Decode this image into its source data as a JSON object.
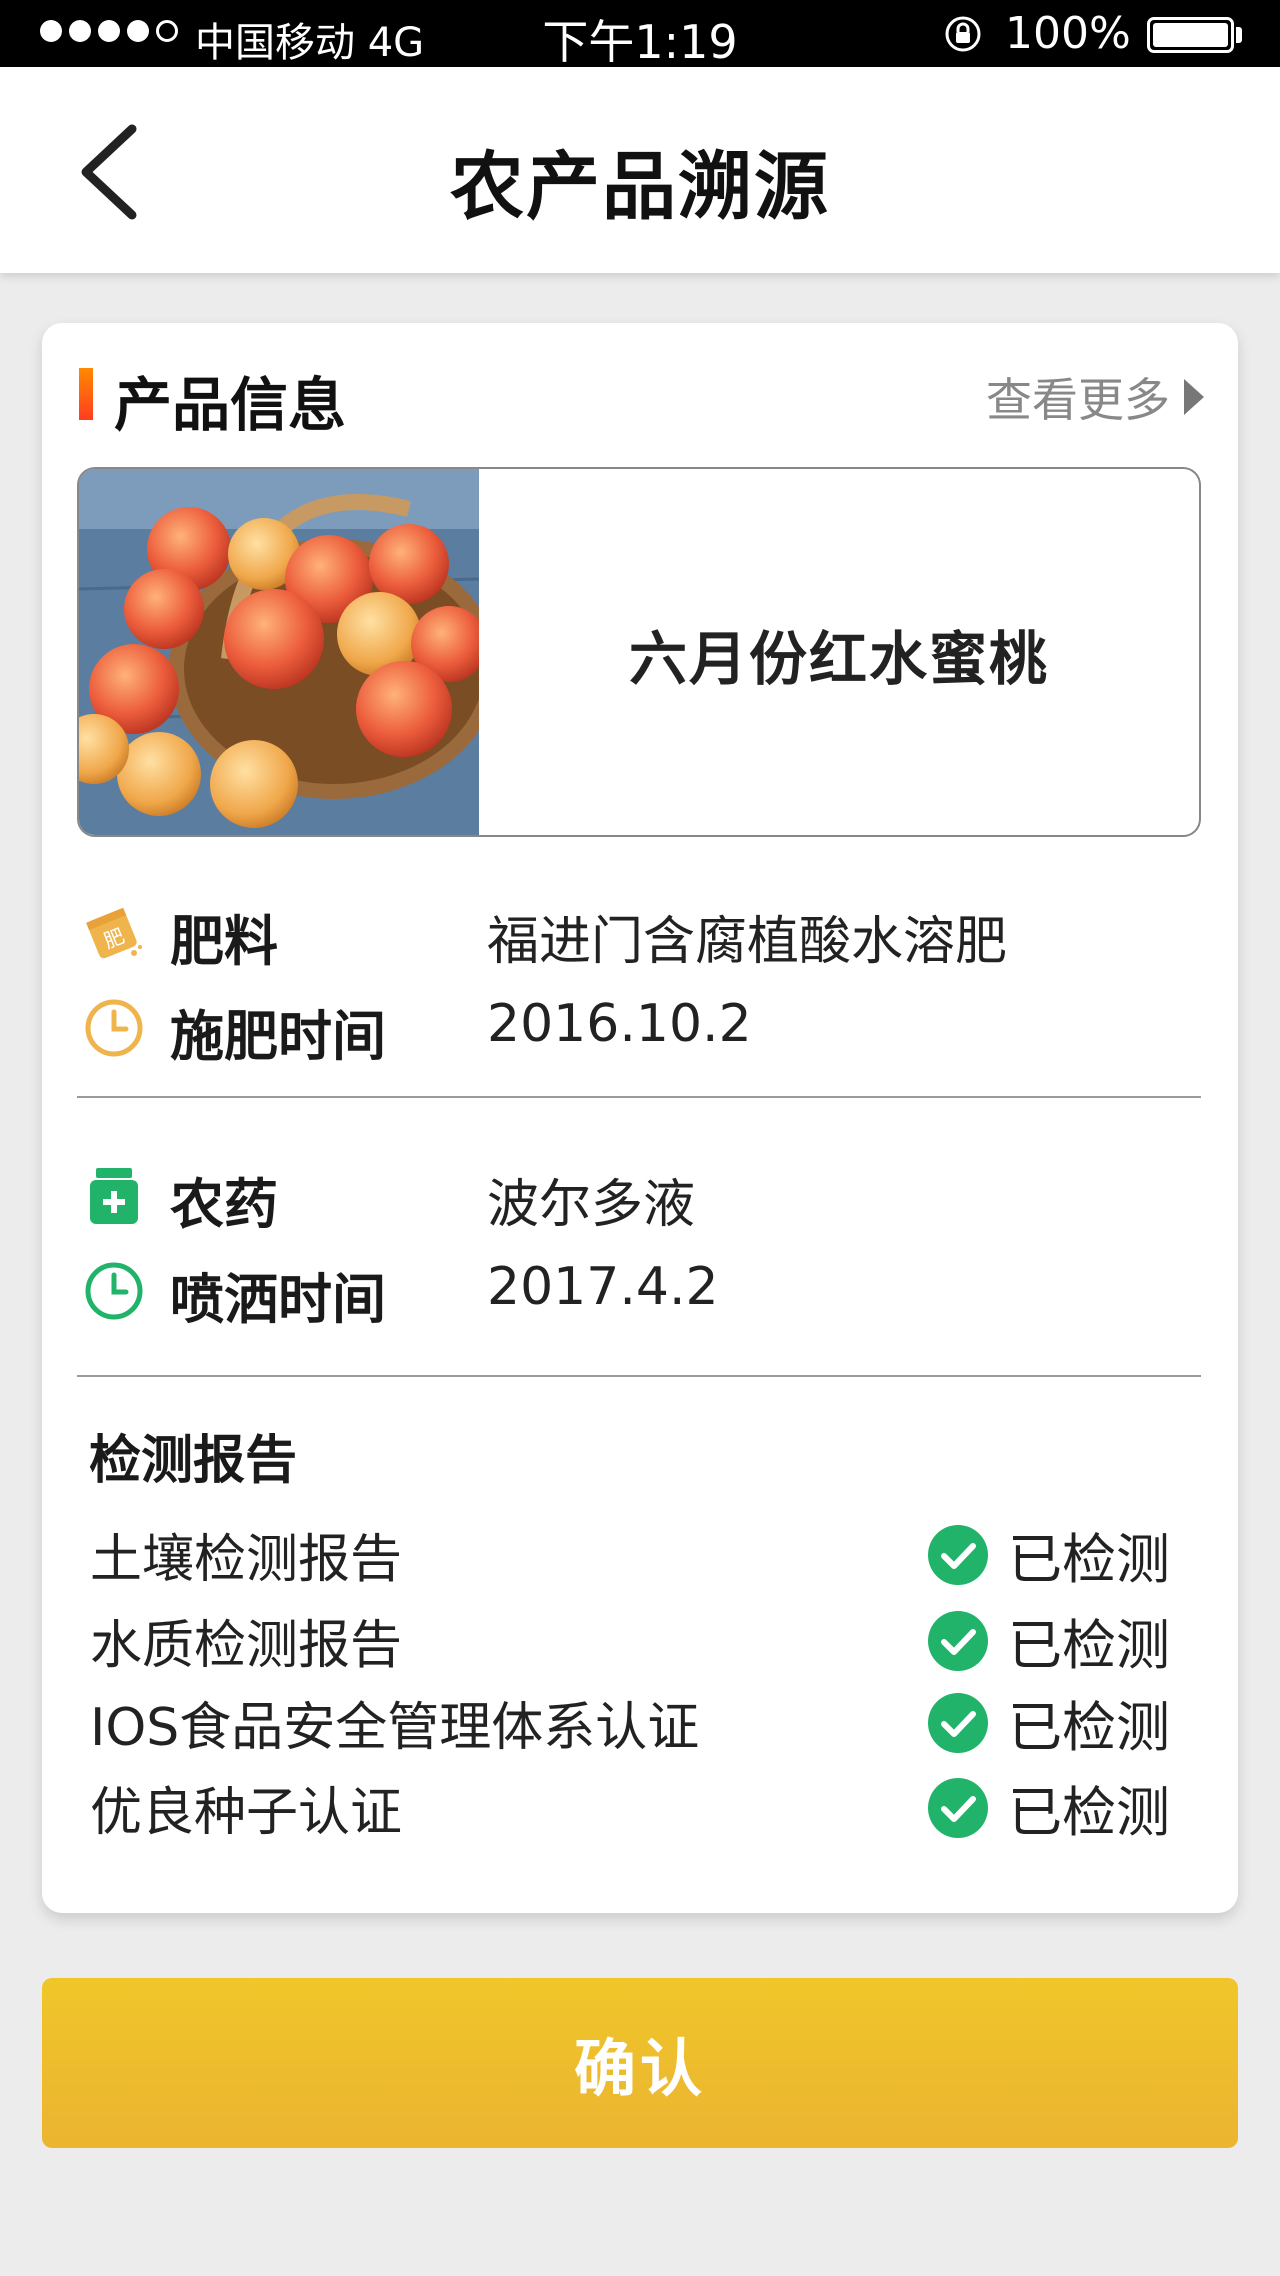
{
  "status_bar": {
    "carrier": "中国移动  4G",
    "time": "下午1:19",
    "battery": "100%"
  },
  "nav": {
    "title": "农产品溯源"
  },
  "product_section": {
    "title": "产品信息",
    "more_label": "查看更多"
  },
  "product": {
    "name": "六月份红水蜜桃",
    "image_icon": "peach-basket-photo"
  },
  "fertilizer": {
    "label": "肥料",
    "value": "福进门含腐植酸水溶肥",
    "time_label": "施肥时间",
    "time_value": "2016.10.2",
    "accent": "#f0b44c"
  },
  "pesticide": {
    "label": "农药",
    "value": "波尔多液",
    "time_label": "喷洒时间",
    "time_value": "2017.4.2",
    "accent": "#22b36a"
  },
  "reports": {
    "title": "检测报告",
    "items": [
      {
        "name": "土壤检测报告",
        "status": "已检测"
      },
      {
        "name": "水质检测报告",
        "status": "已检测"
      },
      {
        "name": "IOS食品安全管理体系认证",
        "status": "已检测"
      },
      {
        "name": "优良种子认证",
        "status": "已检测"
      }
    ],
    "check_color": "#22b36a"
  },
  "confirm_label": "确认",
  "colors": {
    "primary_button": "#eebd2d",
    "section_bar": "#ff5a14"
  }
}
